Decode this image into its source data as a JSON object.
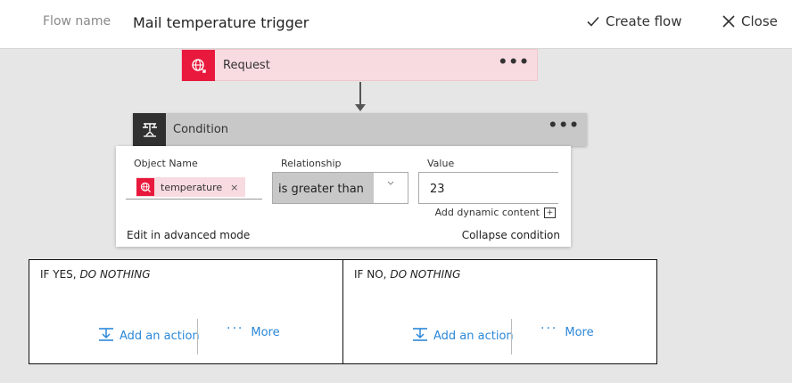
{
  "header": {
    "flow_label": "Flow name",
    "flow_title": "Mail temperature trigger",
    "create_label": "Create flow",
    "close_label": "Close"
  },
  "request": {
    "title": "Request",
    "menu": "•••"
  },
  "condition": {
    "title": "Condition",
    "menu": "•••",
    "object_label": "Object Name",
    "object_token": "temperature",
    "object_token_remove": "×",
    "relationship_label": "Relationship",
    "relationship_value": "is greater than",
    "value_label": "Value",
    "value": "23",
    "dynamic_content": "Add dynamic content",
    "dynamic_content_glyph": "+",
    "advanced_mode": "Edit in advanced mode",
    "collapse": "Collapse condition"
  },
  "branches": {
    "yes": {
      "prefix": "IF YES,",
      "emphasis": "DO NOTHING",
      "add_action": "Add an action",
      "more": "More"
    },
    "no": {
      "prefix": "IF NO,",
      "emphasis": "DO NOTHING",
      "add_action": "Add an action",
      "more": "More"
    }
  },
  "colors": {
    "request_accent": "#e8193c",
    "request_bg": "#f8dbe1",
    "condition_icon_bg": "#303030",
    "condition_header_bg": "#c8c8c8",
    "link_blue": "#2b88d8",
    "canvas_bg": "#e6e6e6"
  },
  "icons": {
    "create": "checkmark-icon",
    "close": "close-icon",
    "request": "globe-request-icon",
    "condition": "condition-icon",
    "add_action": "add-action-icon",
    "more": "more-dots-icon"
  }
}
